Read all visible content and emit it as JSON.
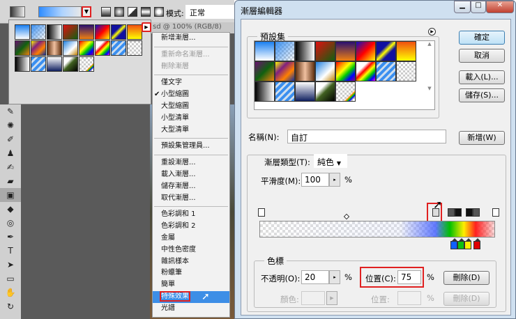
{
  "photoshop": {
    "mode_label": "模式:",
    "mode_value": "正常",
    "doc_tab": "sd @ 100% (RGB/8)",
    "menu": [
      {
        "label": "新增漸層...",
        "enabled": true
      },
      {
        "sep": true
      },
      {
        "label": "重新命名漸層...",
        "enabled": false
      },
      {
        "label": "刪除漸層",
        "enabled": false
      },
      {
        "sep": true
      },
      {
        "label": "僅文字",
        "enabled": true
      },
      {
        "label": "小型縮圖",
        "enabled": true,
        "checked": true
      },
      {
        "label": "大型縮圖",
        "enabled": true
      },
      {
        "label": "小型清單",
        "enabled": true
      },
      {
        "label": "大型清單",
        "enabled": true
      },
      {
        "sep": true
      },
      {
        "label": "預設集管理員...",
        "enabled": true
      },
      {
        "sep": true
      },
      {
        "label": "重設漸層...",
        "enabled": true
      },
      {
        "label": "載入漸層...",
        "enabled": true
      },
      {
        "label": "儲存漸層...",
        "enabled": true
      },
      {
        "label": "取代漸層...",
        "enabled": true
      },
      {
        "sep": true
      },
      {
        "label": "色彩調和 1",
        "enabled": true
      },
      {
        "label": "色彩調和 2",
        "enabled": true
      },
      {
        "label": "金屬",
        "enabled": true
      },
      {
        "label": "中性色密度",
        "enabled": true
      },
      {
        "label": "雜訊樣本",
        "enabled": true
      },
      {
        "label": "粉蠟筆",
        "enabled": true
      },
      {
        "label": "簡單",
        "enabled": true
      },
      {
        "label": "特殊效果",
        "enabled": true,
        "highlighted": true
      },
      {
        "label": "光譜",
        "enabled": true
      }
    ]
  },
  "dialog": {
    "title": "漸層編輯器",
    "presets_legend": "預設集",
    "ok": "確定",
    "cancel": "取消",
    "load": "載入(L)...",
    "save": "儲存(S)...",
    "name_label": "名稱(N):",
    "name_value": "自訂",
    "new": "新增(W)",
    "type_label": "漸層類型(T):",
    "type_value": "純色",
    "smooth_label": "平滑度(M):",
    "smooth_value": "100",
    "pct": "%",
    "stops_legend": "色標",
    "opacity_label": "不透明(O):",
    "opacity_value": "20",
    "location_label": "位置(C):",
    "location_value": "75",
    "delete": "刪除(D)",
    "color_label": "顏色:",
    "color_location_label": "位置:"
  }
}
